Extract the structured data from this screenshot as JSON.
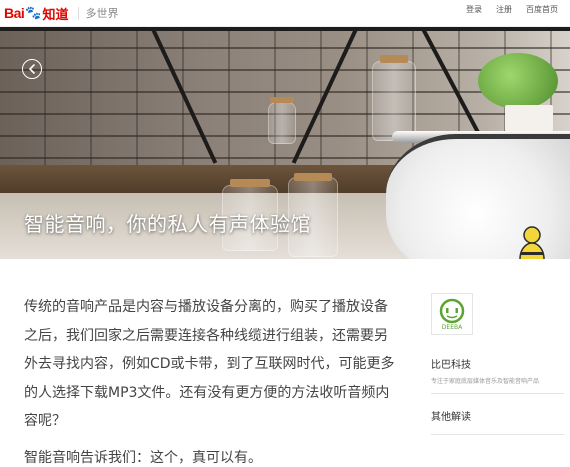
{
  "header": {
    "logo_bai": "Bai",
    "logo_du": "🐾",
    "logo_zhidao": "知道",
    "channel": "多世界",
    "links": [
      "登录",
      "注册",
      "百度首页"
    ]
  },
  "hero": {
    "title": "智能音响，你的私人有声体验馆",
    "back_icon": "chevron-left-icon"
  },
  "article": {
    "paragraphs": [
      "传统的音响产品是内容与播放设备分离的，购买了播放设备之后，我们回家之后需要连接各种线缆进行组装，还需要另外去寻找内容，例如CD或卡带，到了互联网时代，可能更多的人选择下载MP3文件。还有没有更方便的方法收听音频内容呢？",
      "智能音响告诉我们：这个，真可以有。"
    ]
  },
  "sidebar": {
    "brand_logo_text": "DEEBA",
    "brand_name": "比巴科技",
    "brand_desc": "专注于家庭底层媒体音乐及智能音响产品",
    "more_title": "其他解读"
  },
  "colors": {
    "brand_red": "#e10601",
    "brand_blue": "#2d5fe2",
    "deeba_green": "#5aa532"
  }
}
